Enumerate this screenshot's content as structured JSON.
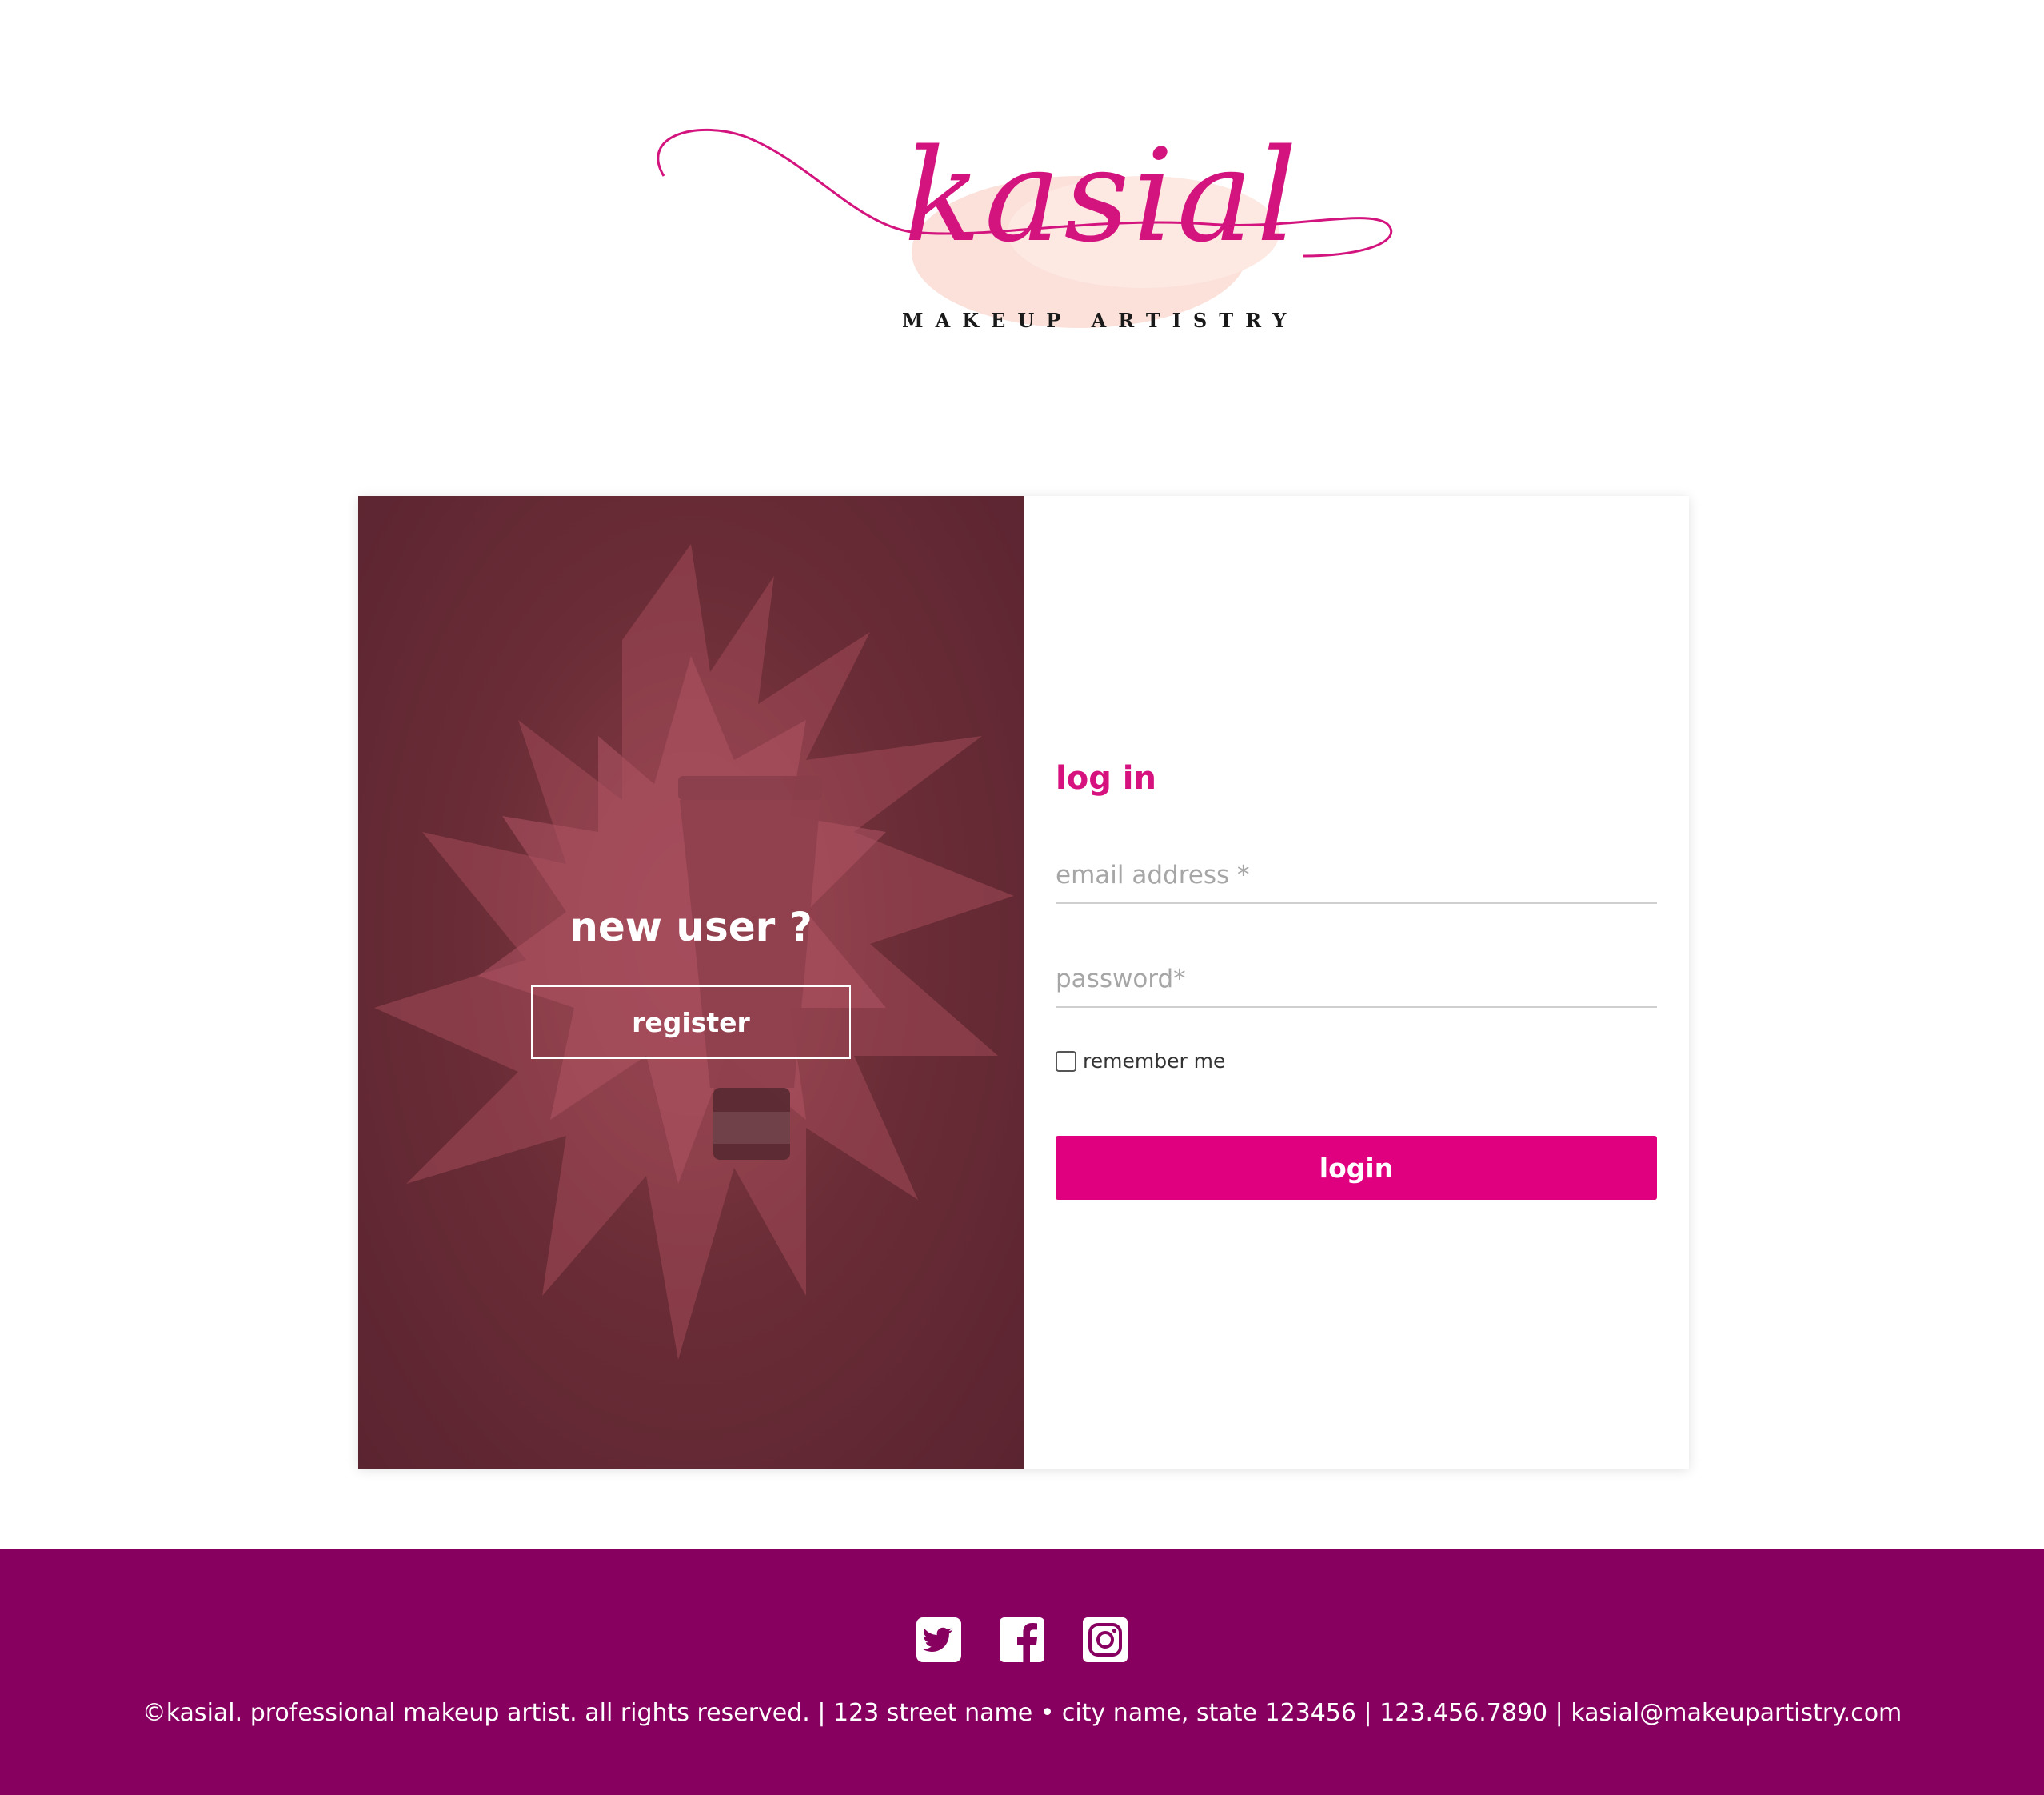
{
  "brand": {
    "name": "kasial",
    "tagline": "MAKEUP ARTISTRY"
  },
  "promo": {
    "title": "new user ?",
    "register_label": "register"
  },
  "login": {
    "title": "log in",
    "email_placeholder": "email address *",
    "password_placeholder": "password*",
    "remember_label": "remember me",
    "submit_label": "login"
  },
  "footer": {
    "social": [
      {
        "icon": "twitter-icon"
      },
      {
        "icon": "facebook-icon"
      },
      {
        "icon": "instagram-icon"
      }
    ],
    "text": "©kasial. professional makeup artist. all rights reserved. | 123 street name • city name, state 123456 | 123.456.7890 | kasial@makeupartistry.com"
  },
  "colors": {
    "accent": "#e0007f",
    "footer_bg": "#870060",
    "promo_bg": "#6b2d37"
  }
}
